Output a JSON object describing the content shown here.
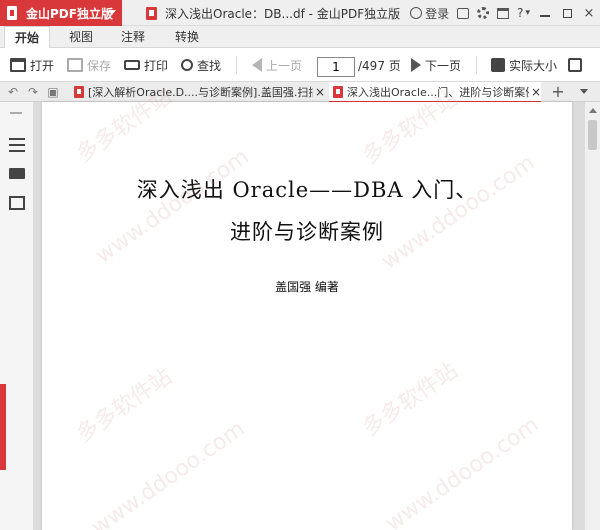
{
  "app": {
    "name": "金山PDF独立版",
    "window_title": "深入浅出Oracle：DB...df - 金山PDF独立版",
    "login_label": "登录",
    "help_label": "?",
    "min_label": "",
    "close_label": "×"
  },
  "menu": {
    "tabs": [
      {
        "label": "开始",
        "active": true
      },
      {
        "label": "视图",
        "active": false
      },
      {
        "label": "注释",
        "active": false
      },
      {
        "label": "转换",
        "active": false
      }
    ]
  },
  "toolbar": {
    "open_label": "打开",
    "save_label": "保存",
    "print_label": "打印",
    "find_label": "查找",
    "prev_label": "上一页",
    "page_current": "1",
    "page_total": "/497 页",
    "next_label": "下一页",
    "actual_size_label": "实际大小"
  },
  "doc_tabs": [
    {
      "label": "[深入解析Oracle.D....与诊断案例].盖国强.扫描版",
      "active": false
    },
    {
      "label": "深入浅出Oracle...门、进阶与诊断案例",
      "active": true
    }
  ],
  "document": {
    "title_line1": "深入浅出 Oracle——DBA 入门、",
    "title_line2": "进阶与诊断案例",
    "author": "盖国强   编著"
  },
  "watermarks": [
    "多多软件站",
    "www.ddooo.com"
  ],
  "colors": {
    "accent": "#d9383a"
  }
}
